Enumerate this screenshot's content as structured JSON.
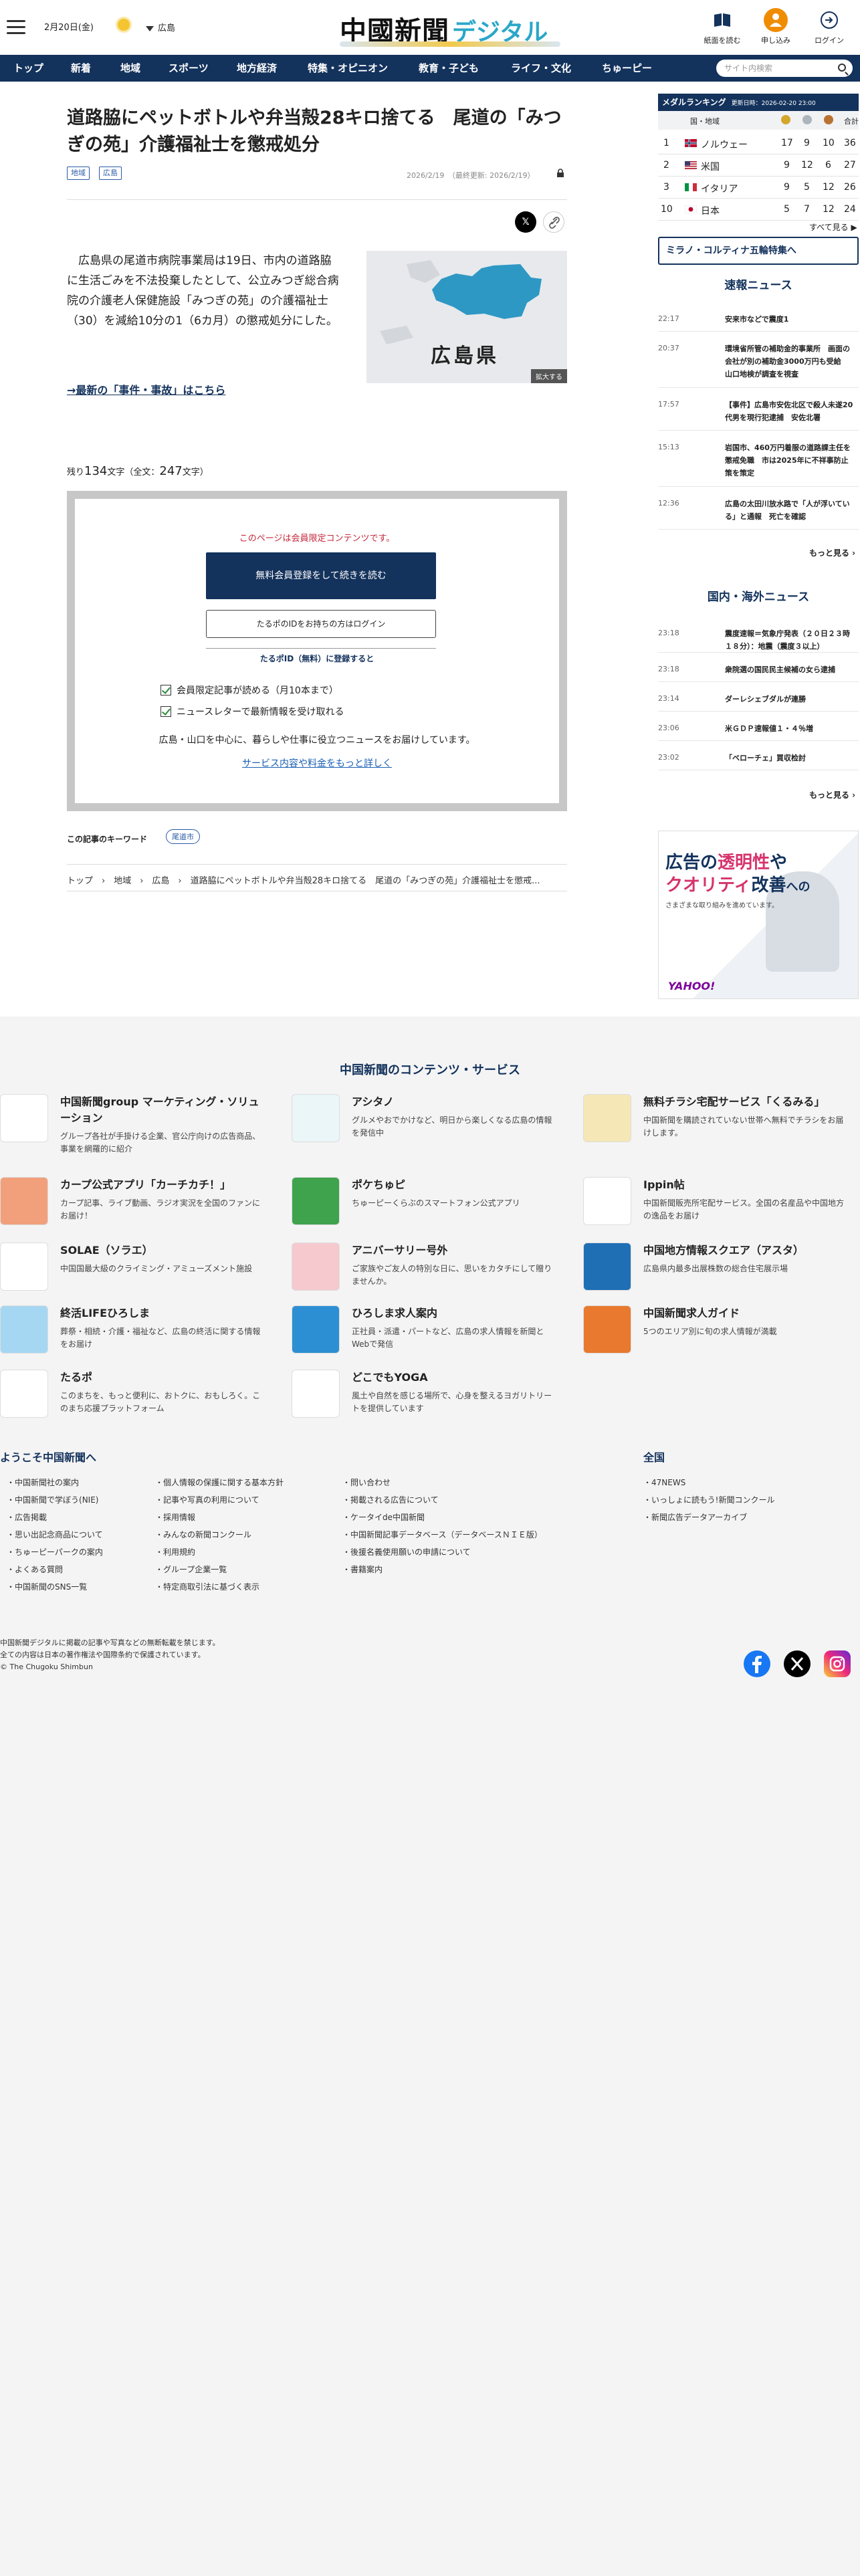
{
  "header": {
    "date": "2月20日(金)",
    "region": "広島",
    "logo_main": "中國新聞",
    "logo_sub": "デジタル",
    "btn_paper": "紙面を読む",
    "btn_signup": "申し込み",
    "btn_login": "ログイン"
  },
  "nav": {
    "items": [
      "トップ",
      "新着",
      "地域",
      "スポーツ",
      "地方経済",
      "特集・オピニオン",
      "教育・子ども",
      "ライフ・文化",
      "ちゅーピー"
    ],
    "search_placeholder": "サイト内検索"
  },
  "article": {
    "title": "道路脇にペットボトルや弁当殻28キロ捨てる　尾道の「みつぎの苑」介護福祉士を懲戒処分",
    "tags": [
      "地域",
      "広島"
    ],
    "meta": "2026/2/19　（最終更新: 2026/2/19）",
    "body": "広島県の尾道市病院事業局は19日、市内の道路脇に生活ごみを不法投棄したとして、公立みつぎ総合病院の介護老人保健施設「みつぎの苑」の介護福祉士（30）を減給10分の1（6カ月）の懲戒処分にした。",
    "map_label": "広島県",
    "map_zoom": "拡大する",
    "latest_link": "→最新の「事件・事故」はこちら",
    "char_prefix": "残り",
    "char_remaining": "134",
    "char_mid": "文字（全文：",
    "char_total": "247",
    "char_suffix": "文字）"
  },
  "paywall": {
    "note": "このページは会員限定コンテンツです。",
    "register_btn": "無料会員登録をして続きを読む",
    "login_btn": "たるポのIDをお持ちの方はログイン",
    "heading": "たるポID（無料）に登録すると",
    "benefits": [
      "会員限定記事が読める（月10本まで）",
      "ニュースレターで最新情報を受け取れる"
    ],
    "area": "広島・山口を中心に、暮らしや仕事に役立つニュースをお届けしています。",
    "more_link": "サービス内容や料金をもっと詳しく"
  },
  "keywords": {
    "label": "この記事のキーワード",
    "tag": "尾道市"
  },
  "breadcrumb": "トップ　›　地域　›　広島　›　道路脇にペットボトルや弁当殻28キロ捨てる　尾道の「みつぎの苑」介護福祉士を懲戒...",
  "sidebar": {
    "medal_title": "メダルランキング",
    "medal_updated": "更新日時：2026-02-20 23:00",
    "medal_col_country": "国・地域",
    "medal_col_total": "合計",
    "medal_rows": [
      {
        "rank": "1",
        "country": "ノルウェー",
        "gold": "17",
        "silver": "9",
        "bronze": "10",
        "total": "36"
      },
      {
        "rank": "2",
        "country": "米国",
        "gold": "9",
        "silver": "12",
        "bronze": "6",
        "total": "27"
      },
      {
        "rank": "3",
        "country": "イタリア",
        "gold": "9",
        "silver": "5",
        "bronze": "12",
        "total": "26"
      },
      {
        "rank": "10",
        "country": "日本",
        "gold": "5",
        "silver": "7",
        "bronze": "12",
        "total": "24"
      }
    ],
    "medal_all": "すべて見る ▶",
    "milano": "ミラノ・コルティナ五輪特集へ",
    "breaking_title": "速報ニュース",
    "breaking": [
      {
        "time": "22:17",
        "text": "安来市などで震度1"
      },
      {
        "time": "20:37",
        "text": "環境省所管の補助金的事業所　画面の会社が別の補助金3000万円も受給　山口地検が調査を視査"
      },
      {
        "time": "17:57",
        "text": "【事件】広島市安佐北区で殺人未遂20代男を現行犯逮捕　安佐北署"
      },
      {
        "time": "15:13",
        "text": "岩国市、460万円着服の道路課主任を懲戒免職　市は2025年に不祥事防止策を策定"
      },
      {
        "time": "12:36",
        "text": "広島の太田川放水路で「人が浮いている」と通報　死亡を確認"
      }
    ],
    "more": "もっと見る ›",
    "intl_title": "国内・海外ニュース",
    "intl": [
      {
        "time": "23:18",
        "text": "震度速報＝気象庁発表（２０日２３時１８分）：地震（震度３以上）"
      },
      {
        "time": "23:18",
        "text": "衆院選の国民民主候補の女ら逮捕"
      },
      {
        "time": "23:14",
        "text": "ダーレシェブダルが連勝"
      },
      {
        "time": "23:06",
        "text": "米ＧＤＰ速報値１・４％増"
      },
      {
        "time": "23:02",
        "text": "「ベローチェ」買収检討"
      }
    ],
    "ad_line1a": "広告の",
    "ad_line1b": "透明性",
    "ad_line1c": "や",
    "ad_line2a": "クオリティ",
    "ad_line2b": "改善",
    "ad_line2c": "への",
    "ad_sub": "さまざまな取り組みを進めています。",
    "ad_brand": "YAHOO!"
  },
  "footer": {
    "title": "中国新聞のコンテンツ・サービス",
    "services": [
      {
        "name": "中国新聞group マーケティング・ソリューション",
        "desc": "グループ各社が手掛ける企業、官公庁向けの広告商品、事業を網羅的に紹介",
        "icon": "marketing-icon",
        "color": "#ffffff"
      },
      {
        "name": "アシタノ",
        "desc": "グルメやおでかけなど、明日から楽しくなる広島の情報を発信中",
        "icon": "ashitano-icon",
        "color": "#eaf6f7"
      },
      {
        "name": "無料チラシ宅配サービス「くるみる」",
        "desc": "中国新聞を購読されていない世帯へ無料でチラシをお届けします。",
        "icon": "kurumiru-icon",
        "color": "#f6e7b6"
      },
      {
        "name": "カープ公式アプリ「カーチカチ！」",
        "desc": "カープ記事、ライブ動画、ラジオ実況を全国のファンにお届け！",
        "icon": "carp-app-icon",
        "color": "#f2a07b"
      },
      {
        "name": "ポケちゅピ",
        "desc": "ちゅーピーくらぶのスマートフォン公式アプリ",
        "icon": "pokechupi-icon",
        "color": "#3fa34d"
      },
      {
        "name": "Ippin帖",
        "desc": "中国新聞販売所宅配サービス。全国の名産品や中国地方の逸品をお届け",
        "icon": "ippin-icon",
        "color": "#ffffff"
      },
      {
        "name": "SOLAE（ソラエ）",
        "desc": "中国国最大級のクライミング・アミューズメント施設",
        "icon": "solae-icon",
        "color": "#ffffff"
      },
      {
        "name": "アニバーサリー号外",
        "desc": "ご家族やご友人の特別な日に、思いをカタチにして贈りませんか。",
        "icon": "anniversary-icon",
        "color": "#f6c9cf"
      },
      {
        "name": "中国地方情報スクエア（アスタ）",
        "desc": "広島県内最多出展株数の総合住宅展示場",
        "icon": "asta-icon",
        "color": "#1f6fb5"
      },
      {
        "name": "終活LIFEひろしま",
        "desc": "葬祭・相続・介護・福祉など、広島の終活に関する情報をお届け",
        "icon": "shukatsu-icon",
        "color": "#a6d7f2"
      },
      {
        "name": "ひろしま求人案内",
        "desc": "正社員・派遣・パートなど、広島の求人情報を新聞とWebで発信",
        "icon": "kyujin-annai-icon",
        "color": "#2d8fd3"
      },
      {
        "name": "中国新聞求人ガイド",
        "desc": "5つのエリア別に旬の求人情報が満載",
        "icon": "kyujin-guide-icon",
        "color": "#e8792e"
      },
      {
        "name": "たるポ",
        "desc": "このまちを、もっと便利に、おトクに、おもしろく。このまち応援プラットフォーム",
        "icon": "tarupo-icon",
        "color": "#ffffff"
      },
      {
        "name": "どこでもYOGA",
        "desc": "風土や自然を感じる場所で、心身を整えるヨガリトリートを提供しています",
        "icon": "yoga-icon",
        "color": "#ffffff"
      }
    ],
    "welcome_title": "ようこそ中国新聞へ",
    "col1": [
      "中国新聞社の案内",
      "中国新聞で学ぼう(NIE)",
      "広告掲載",
      "思い出記念商品について",
      "ちゅーピーパークの案内",
      "よくある質問",
      "中国新聞のSNS一覧"
    ],
    "col2": [
      "個人情報の保護に関する基本方針",
      "記事や写真の利用について",
      "採用情報",
      "みんなの新聞コンクール",
      "利用規約",
      "グループ企業一覧",
      "特定商取引法に基づく表示"
    ],
    "col3": [
      "問い合わせ",
      "掲載される広告について",
      "ケータイde中国新聞",
      "中国新聞記事データベース（データベースＮＩＥ版）",
      "後援名義使用願いの申請について",
      "書籍案内"
    ],
    "national_title": "全国",
    "national": [
      "47NEWS",
      "いっしょに読もう!新聞コンクール",
      "新聞広告データアーカイブ"
    ],
    "copyright1": "中国新聞デジタルに掲載の記事や写真などの無断転載を禁じます。",
    "copyright2": "全ての内容は日本の著作権法や国際条約で保護されています。",
    "copyright3": "© The Chugoku Shimbun"
  },
  "colors": {
    "navy": "#13325c",
    "accent_orange": "#f08c00",
    "footer_bg": "#f4f4f4"
  }
}
